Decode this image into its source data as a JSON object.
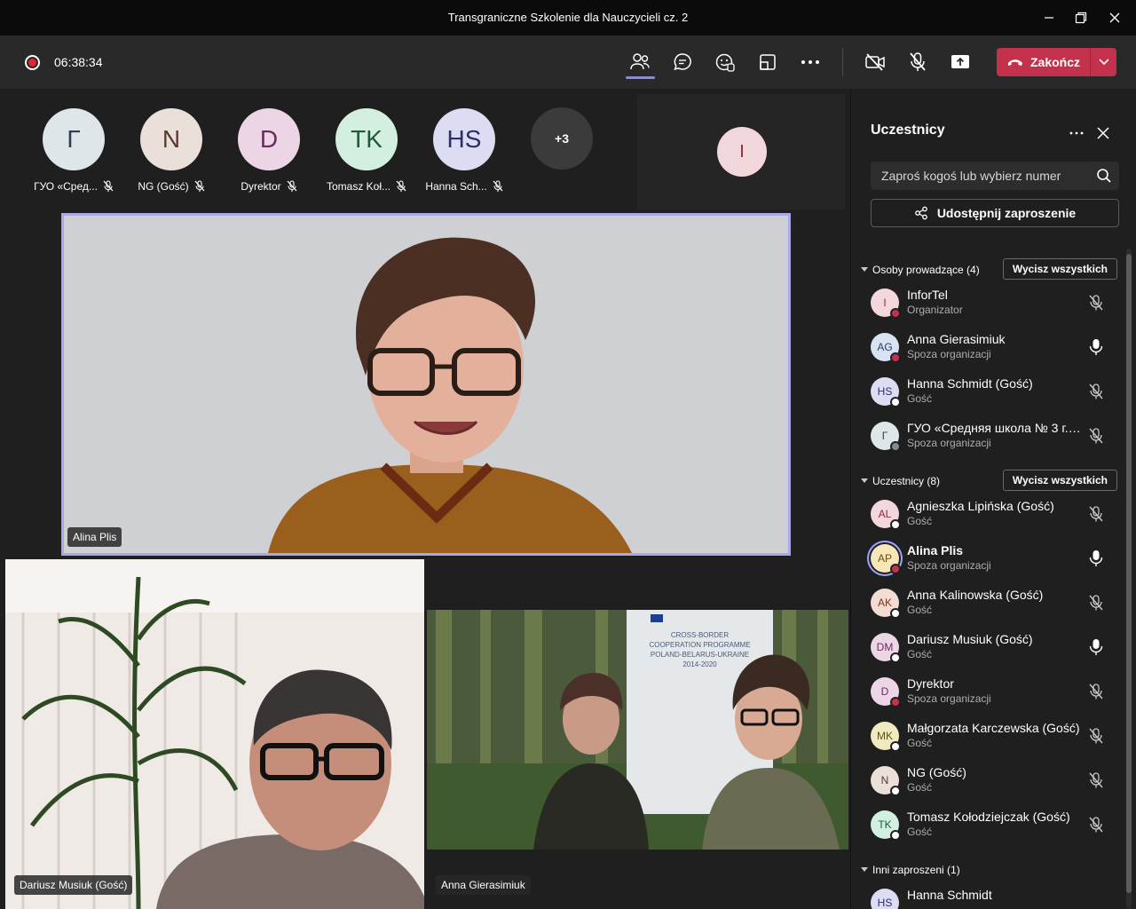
{
  "window": {
    "title": "Transgraniczne Szkolenie dla Nauczycieli cz. 2"
  },
  "toolbar": {
    "recording_time": "06:38:34",
    "end_label": "Zakończ"
  },
  "gallery": {
    "tiles": [
      {
        "initials": "Г",
        "name": "ГУО «Сред...",
        "bg": "#dfe6e9",
        "fg": "#2c3e50"
      },
      {
        "initials": "N",
        "name": "NG (Gość)",
        "bg": "#eadfd9",
        "fg": "#5a3a2e"
      },
      {
        "initials": "D",
        "name": "Dyrektor",
        "bg": "#ecd6e6",
        "fg": "#6b2a5e"
      },
      {
        "initials": "TK",
        "name": "Tomasz Koł...",
        "bg": "#d2efdf",
        "fg": "#1e5a3a"
      },
      {
        "initials": "HS",
        "name": "Hanna Sch...",
        "bg": "#dcdcf2",
        "fg": "#2e2e6b"
      }
    ],
    "more_label": "+3",
    "self_initial": "I"
  },
  "stage": {
    "main_speaker": "Alina Plis",
    "bottom_left": "Dariusz Musiuk (Gość)",
    "bottom_right": "Anna Gierasimiuk",
    "banner_text": [
      "CROSS-BORDER",
      "COOPERATION PROGRAMME",
      "POLAND-BELARUS-UKRAINE",
      "2014-2020"
    ]
  },
  "panel": {
    "title": "Uczestnicy",
    "search_placeholder": "Zaproś kogoś lub wybierz numer",
    "share_label": "Udostępnij zaproszenie",
    "mute_all_label": "Wycisz wszystkich",
    "sections": [
      {
        "label": "Osoby prowadzące (4)",
        "people": [
          {
            "initials": "I",
            "name": "InforTel",
            "role": "Organizator",
            "bg": "#f2d7dc",
            "fg": "#8a2b3d",
            "presence": "#c4314b",
            "mic": "muted"
          },
          {
            "initials": "AG",
            "name": "Anna Gierasimiuk",
            "role": "Spoza organizacji",
            "bg": "#d8e2f2",
            "fg": "#28406b",
            "presence": "#c4314b",
            "mic": "on"
          },
          {
            "initials": "HS",
            "name": "Hanna Schmidt (Gość)",
            "role": "Gość",
            "bg": "#dcdcf2",
            "fg": "#2e2e6b",
            "presence": "#ffffff",
            "mic": "muted"
          },
          {
            "initials": "Г",
            "name": "ГУО «Средняя школа № 3 г. ...",
            "role": "Spoza organizacji",
            "bg": "#dfe6e9",
            "fg": "#2c3e50",
            "presence": "#8a8a8a",
            "mic": "muted"
          }
        ]
      },
      {
        "label": "Uczestnicy (8)",
        "people": [
          {
            "initials": "AL",
            "name": "Agnieszka Lipińska (Gość)",
            "role": "Gość",
            "bg": "#f2d7dc",
            "fg": "#8a2b3d",
            "presence": "#ffffff",
            "mic": "muted"
          },
          {
            "initials": "AP",
            "name": "Alina Plis",
            "role": "Spoza organizacji",
            "bg": "#f6e6b8",
            "fg": "#6b4e00",
            "presence": "#c4314b",
            "mic": "on",
            "bold": true,
            "speaking": true
          },
          {
            "initials": "AK",
            "name": "Anna Kalinowska (Gość)",
            "role": "Gość",
            "bg": "#f3dcd3",
            "fg": "#7a3520",
            "presence": "#ffffff",
            "mic": "muted"
          },
          {
            "initials": "DM",
            "name": "Dariusz Musiuk (Gość)",
            "role": "Gość",
            "bg": "#ecd6e6",
            "fg": "#6b2a5e",
            "presence": "#ffffff",
            "mic": "on"
          },
          {
            "initials": "D",
            "name": "Dyrektor",
            "role": "Spoza organizacji",
            "bg": "#ecd6e6",
            "fg": "#6b2a5e",
            "presence": "#c4314b",
            "mic": "muted"
          },
          {
            "initials": "MK",
            "name": "Małgorzata Karczewska (Gość)",
            "role": "Gość",
            "bg": "#f1e9bf",
            "fg": "#5e5410",
            "presence": "#ffffff",
            "mic": "muted"
          },
          {
            "initials": "N",
            "name": "NG (Gość)",
            "role": "Gość",
            "bg": "#eadfd9",
            "fg": "#5a3a2e",
            "presence": "#ffffff",
            "mic": "muted"
          },
          {
            "initials": "TK",
            "name": "Tomasz Kołodziejczak (Gość)",
            "role": "Gość",
            "bg": "#d2efdf",
            "fg": "#1e5a3a",
            "presence": "#ffffff",
            "mic": "muted"
          }
        ]
      },
      {
        "label": "Inni zaproszeni (1)",
        "people": [
          {
            "initials": "HS",
            "name": "Hanna Schmidt",
            "role": "",
            "bg": "#dcdcf2",
            "fg": "#2e2e6b",
            "presence": "",
            "mic": ""
          }
        ]
      }
    ]
  }
}
